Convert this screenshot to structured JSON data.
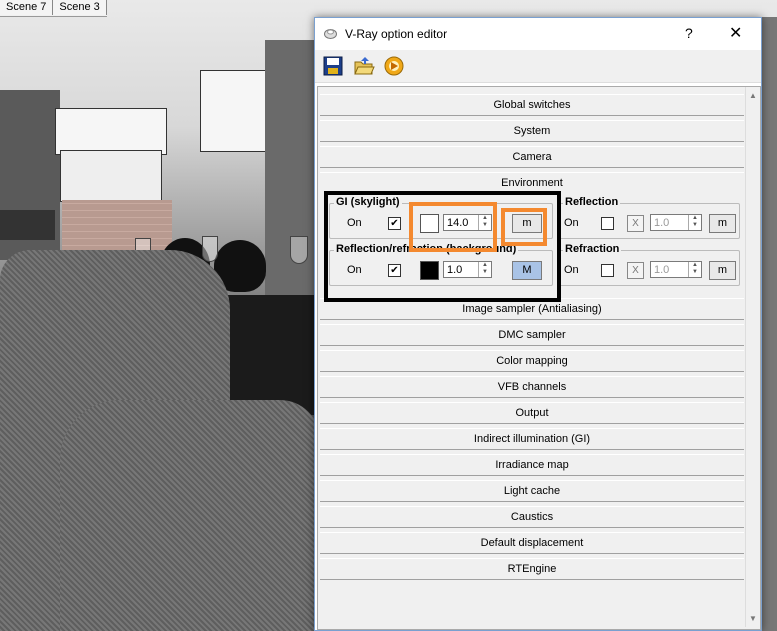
{
  "scene_tabs": [
    "Scene 7",
    "Scene 3"
  ],
  "dialog": {
    "title": "V-Ray option editor",
    "help": "?",
    "close": "✕"
  },
  "rollouts_top": [
    "Global switches",
    "System",
    "Camera",
    "Environment"
  ],
  "environment": {
    "gi_group": "GI (skylight)",
    "gi_on_label": "On",
    "gi_on_checked": "✔",
    "gi_value": "14.0",
    "gi_map_btn": "m",
    "refl_group": "Reflection",
    "refl_on_label": "On",
    "refl_x": "X",
    "refl_value": "1.0",
    "refl_map_btn": "m",
    "bg_group": "Reflection/refraction (background)",
    "bg_on_label": "On",
    "bg_on_checked": "✔",
    "bg_value": "1.0",
    "bg_map_btn": "M",
    "refr_group": "Refraction",
    "refr_on_label": "On",
    "refr_x": "X",
    "refr_value": "1.0",
    "refr_map_btn": "m",
    "gi_color": "#ffffff",
    "bg_color": "#000000"
  },
  "rollouts_bottom": [
    "Image sampler (Antialiasing)",
    "DMC sampler",
    "Color mapping",
    "VFB channels",
    "Output",
    "Indirect illumination (GI)",
    "Irradiance map",
    "Light cache",
    "Caustics",
    "Default displacement",
    "RTEngine"
  ],
  "colors": {
    "highlight_orange": "#f4892f",
    "highlight_black": "#000000"
  }
}
